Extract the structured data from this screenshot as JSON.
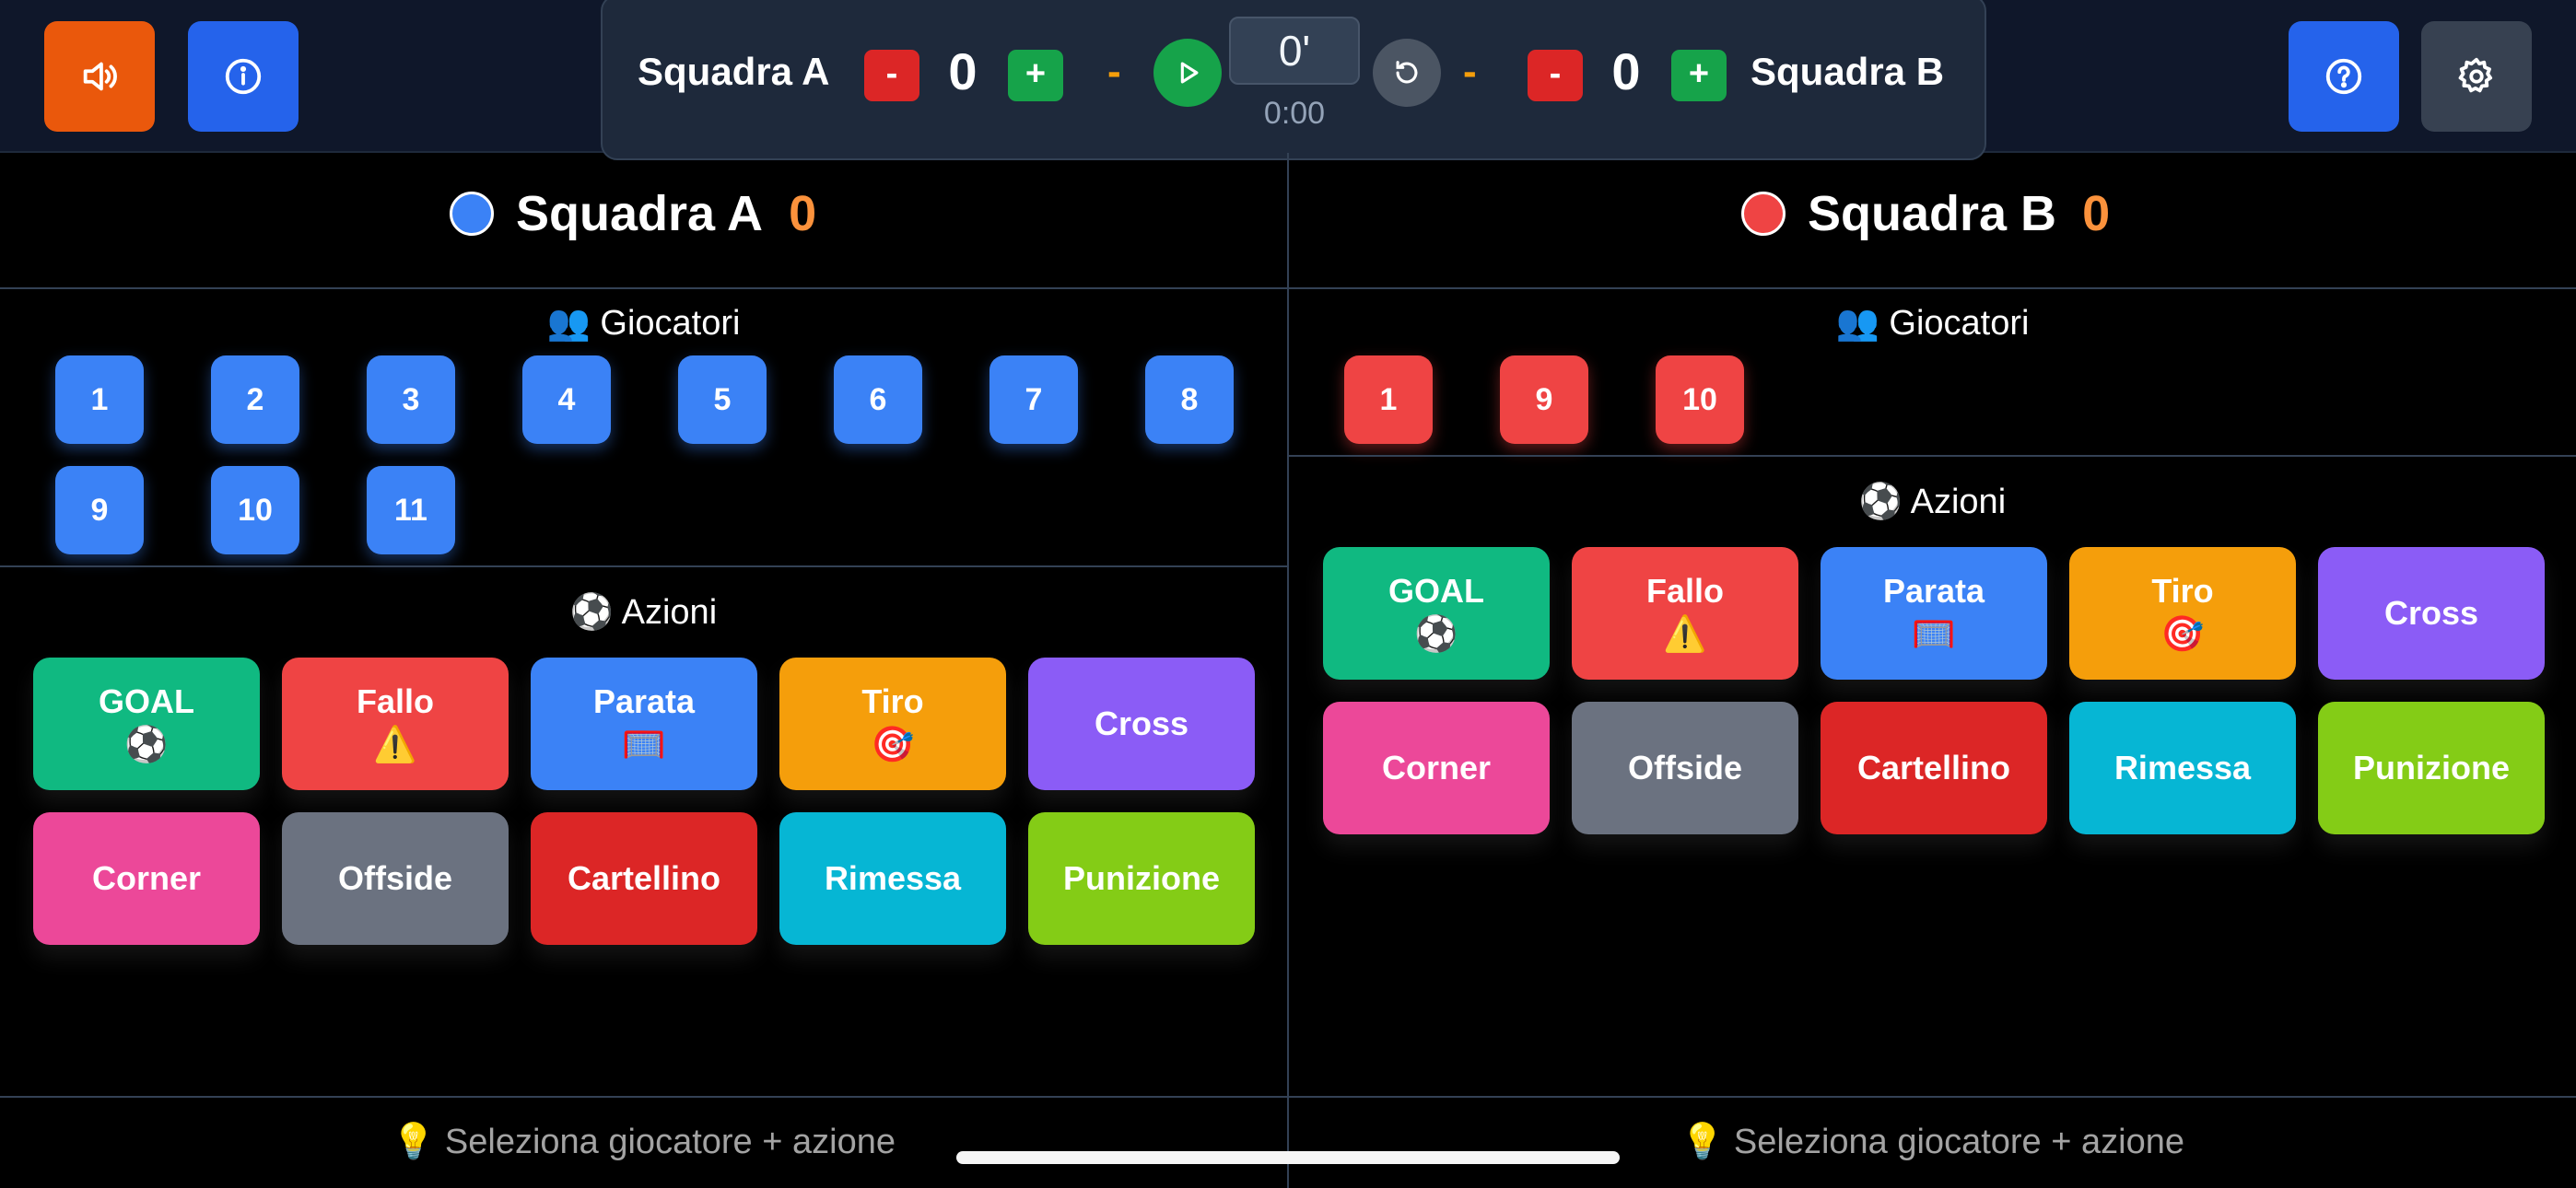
{
  "colors": {
    "sound_btn": "#ea580c",
    "info_btn": "#2563eb",
    "help_btn": "#2563eb",
    "settings_btn": "#374151",
    "team_a": "#3b82f6",
    "team_b": "#ef4444",
    "score": "#fb923c"
  },
  "toolbar": {
    "sound_icon": "speaker-icon",
    "info_icon": "info-icon",
    "help_icon": "question-circle-icon",
    "settings_icon": "gear-icon"
  },
  "scoreboard": {
    "team_a_name": "Squadra A",
    "team_a_score": "0",
    "team_b_name": "Squadra B",
    "team_b_score": "0",
    "minus_label": "-",
    "plus_label": "+",
    "separator": "-",
    "minute": "0'",
    "timer": "0:00",
    "play_icon": "play-icon",
    "reset_icon": "reset-icon"
  },
  "teams": [
    {
      "name": "Squadra A",
      "score": "0",
      "players_label": "👥 Giocatori",
      "players": [
        "1",
        "2",
        "3",
        "4",
        "5",
        "6",
        "7",
        "8",
        "9",
        "10",
        "11"
      ],
      "actions_label": "⚽ Azioni",
      "hint": "💡 Seleziona giocatore + azione"
    },
    {
      "name": "Squadra B",
      "score": "0",
      "players_label": "👥 Giocatori",
      "players": [
        "1",
        "9",
        "10"
      ],
      "actions_label": "⚽ Azioni",
      "hint": "💡 Seleziona giocatore + azione"
    }
  ],
  "actions": [
    {
      "label": "GOAL",
      "emoji": "⚽",
      "color": "#10b981"
    },
    {
      "label": "Fallo",
      "emoji": "⚠️",
      "color": "#ef4444"
    },
    {
      "label": "Parata",
      "emoji": "🥅",
      "color": "#3b82f6"
    },
    {
      "label": "Tiro",
      "emoji": "🎯",
      "color": "#f59e0b"
    },
    {
      "label": "Cross",
      "emoji": "",
      "color": "#8b5cf6"
    },
    {
      "label": "Corner",
      "emoji": "",
      "color": "#ec4899"
    },
    {
      "label": "Offside",
      "emoji": "",
      "color": "#6b7280"
    },
    {
      "label": "Cartellino",
      "emoji": "",
      "color": "#dc2626"
    },
    {
      "label": "Rimessa",
      "emoji": "",
      "color": "#06b6d4"
    },
    {
      "label": "Punizione",
      "emoji": "",
      "color": "#84cc16"
    }
  ]
}
